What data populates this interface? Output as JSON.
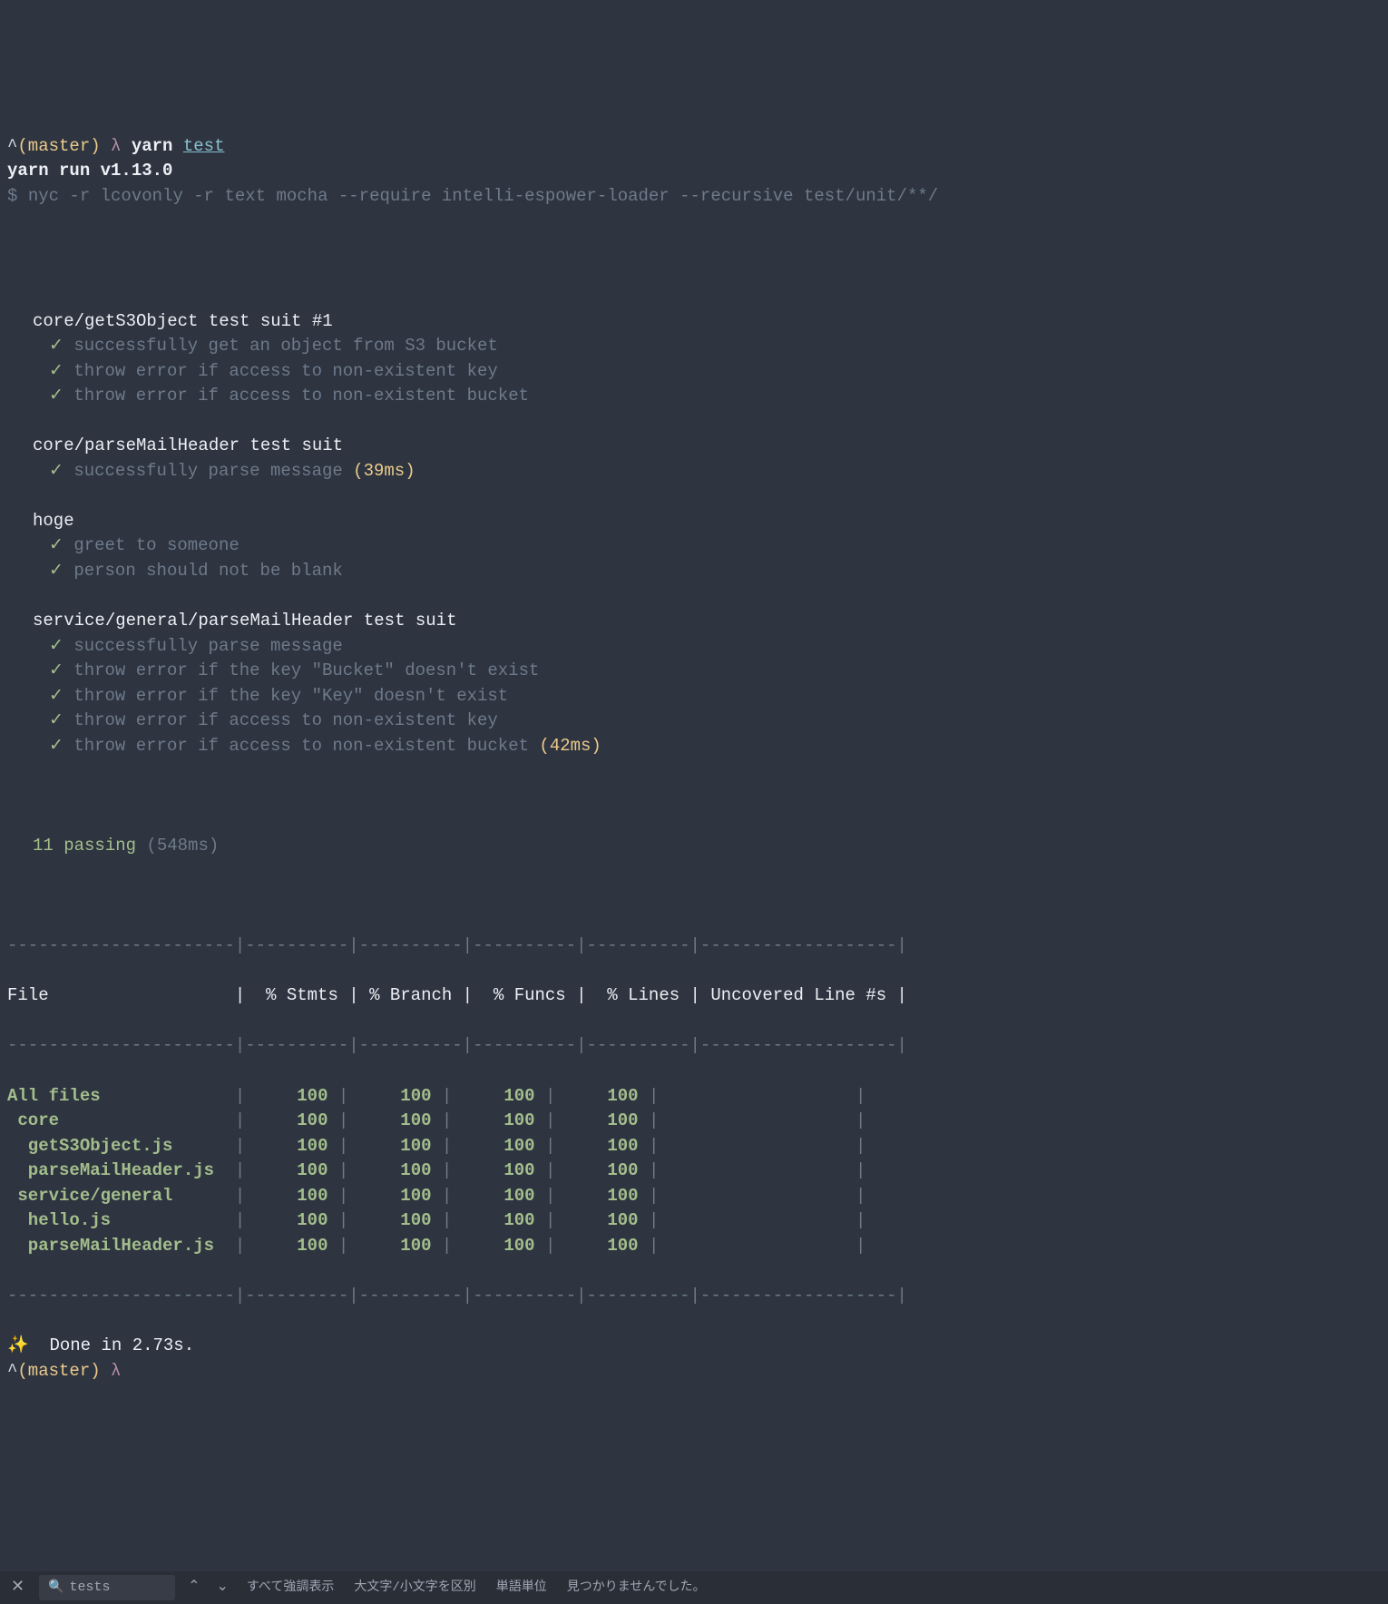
{
  "prompt1": {
    "caret": "^",
    "branch": "(master)",
    "lambda": "λ",
    "cmd_prefix": "yarn ",
    "cmd_link": "test"
  },
  "yarn_run": "yarn run v1.13.0",
  "dollar": "$ ",
  "nyc_cmd": "nyc -r lcovonly -r text mocha --require intelli-espower-loader --recursive test/unit/**/",
  "suites": [
    {
      "title": "core/getS3Object test suit #1",
      "tests": [
        {
          "text": "successfully get an object from S3 bucket",
          "time": ""
        },
        {
          "text": "throw error if access to non-existent key",
          "time": ""
        },
        {
          "text": "throw error if access to non-existent bucket",
          "time": ""
        }
      ]
    },
    {
      "title": "core/parseMailHeader test suit",
      "tests": [
        {
          "text": "successfully parse message",
          "time": " (39ms)"
        }
      ]
    },
    {
      "title": "hoge",
      "tests": [
        {
          "text": "greet to someone",
          "time": ""
        },
        {
          "text": "person should not be blank",
          "time": ""
        }
      ]
    },
    {
      "title": "service/general/parseMailHeader test suit",
      "tests": [
        {
          "text": "successfully parse message",
          "time": ""
        },
        {
          "text": "throw error if the key \"Bucket\" doesn't exist",
          "time": ""
        },
        {
          "text": "throw error if the key \"Key\" doesn't exist",
          "time": ""
        },
        {
          "text": "throw error if access to non-existent key",
          "time": ""
        },
        {
          "text": "throw error if access to non-existent bucket",
          "time": " (42ms)"
        }
      ]
    }
  ],
  "summary": {
    "passing": "11 passing",
    "time": " (548ms)"
  },
  "table": {
    "sep_top": "----------------------|----------|----------|----------|----------|-------------------|",
    "header": "File                  |  % Stmts | % Branch |  % Funcs |  % Lines | Uncovered Line #s |",
    "sep_mid": "----------------------|----------|----------|----------|----------|-------------------|",
    "rows": [
      {
        "file": "All files            ",
        "s": "100",
        "b": "100",
        "f": "100",
        "l": "100",
        "u": ""
      },
      {
        "file": " core                ",
        "s": "100",
        "b": "100",
        "f": "100",
        "l": "100",
        "u": ""
      },
      {
        "file": "  getS3Object.js     ",
        "s": "100",
        "b": "100",
        "f": "100",
        "l": "100",
        "u": ""
      },
      {
        "file": "  parseMailHeader.js ",
        "s": "100",
        "b": "100",
        "f": "100",
        "l": "100",
        "u": ""
      },
      {
        "file": " service/general     ",
        "s": "100",
        "b": "100",
        "f": "100",
        "l": "100",
        "u": ""
      },
      {
        "file": "  hello.js           ",
        "s": "100",
        "b": "100",
        "f": "100",
        "l": "100",
        "u": ""
      },
      {
        "file": "  parseMailHeader.js ",
        "s": "100",
        "b": "100",
        "f": "100",
        "l": "100",
        "u": ""
      }
    ],
    "sep_bot": "----------------------|----------|----------|----------|----------|-------------------|"
  },
  "done": {
    "sparkle": "✨",
    "text": "  Done in 2.73s."
  },
  "prompt2": {
    "caret": "^",
    "branch": "(master)",
    "lambda": "λ"
  },
  "findbar": {
    "close": "✕",
    "search_value": "tests",
    "up": "⌃",
    "down": "⌄",
    "highlight_all": "すべて強調表示",
    "match_case": "大文字/小文字を区別",
    "whole_word": "単語単位",
    "not_found": "見つかりませんでした。"
  }
}
